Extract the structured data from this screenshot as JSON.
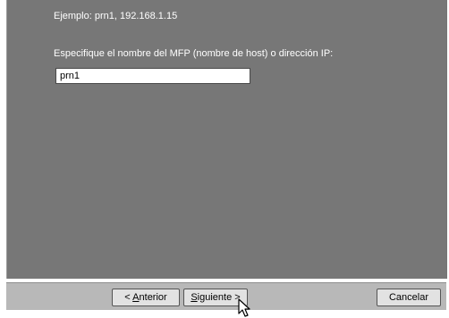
{
  "form": {
    "example_text": "Ejemplo: prn1, 192.168.1.15",
    "prompt_label": "Especifique el nombre del MFP (nombre de host) o dirección IP:",
    "host_input_value": "prn1"
  },
  "buttons": {
    "back_prefix": "< ",
    "back_mnemonic": "A",
    "back_rest": "nterior",
    "next_mnemonic": "S",
    "next_rest": "iguiente >",
    "cancel_label": "Cancelar"
  },
  "colors": {
    "panel_background": "#777777",
    "button_bar": "#b8b8b8"
  },
  "icons": {
    "cursor": "arrow-cursor-icon"
  }
}
